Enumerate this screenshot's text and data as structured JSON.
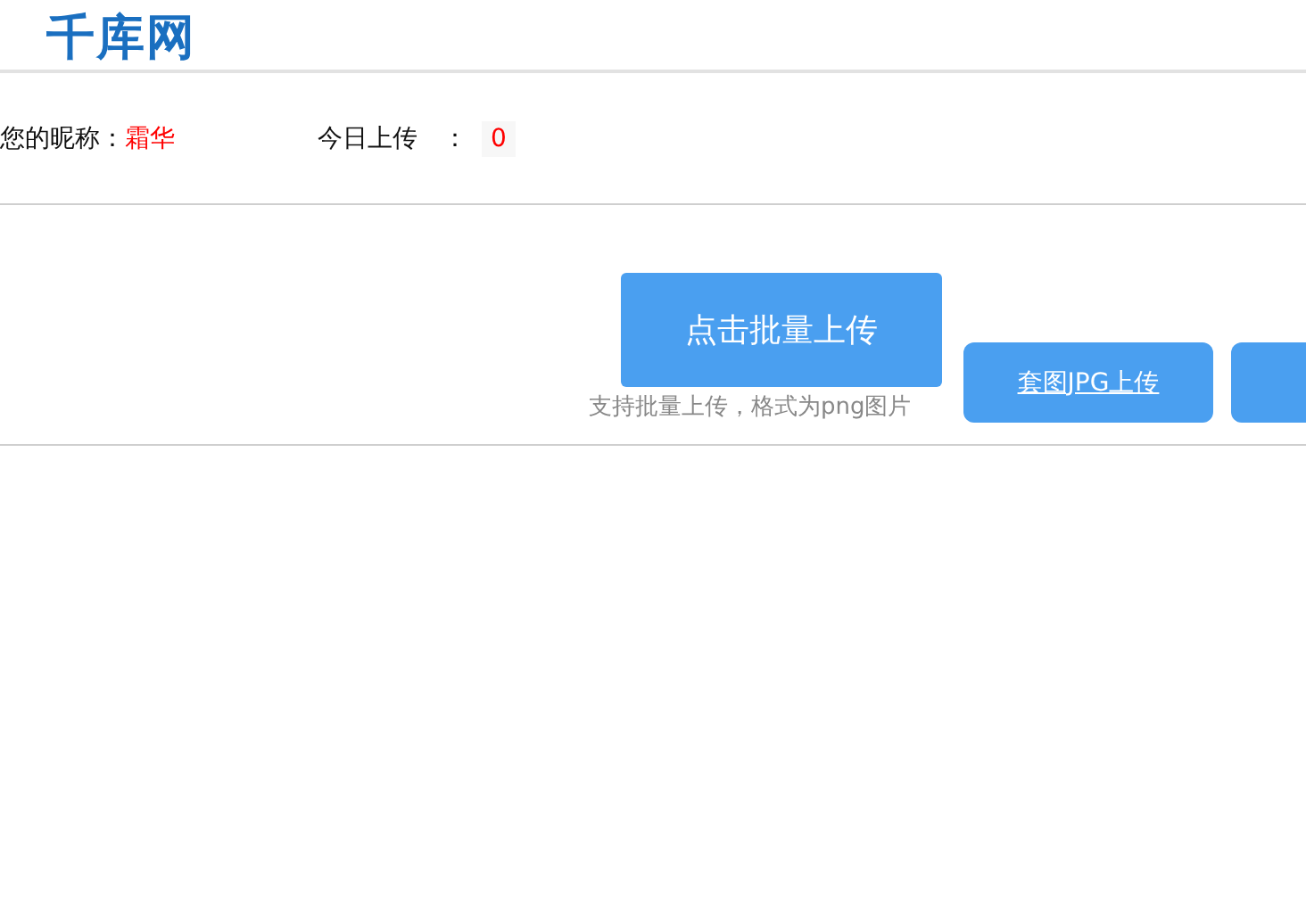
{
  "header": {
    "logo": "千库网"
  },
  "user_info": {
    "nickname_label": "您的昵称：",
    "nickname": "霜华",
    "today_label": "今日上传",
    "separator": "：",
    "today_count": "0"
  },
  "upload": {
    "button": "点击批量上传",
    "hint": "支持批量上传，格式为png图片",
    "buttons": [
      {
        "kind": "labeled",
        "label": "套图JPG上传"
      },
      {
        "kind": "cut"
      }
    ]
  }
}
